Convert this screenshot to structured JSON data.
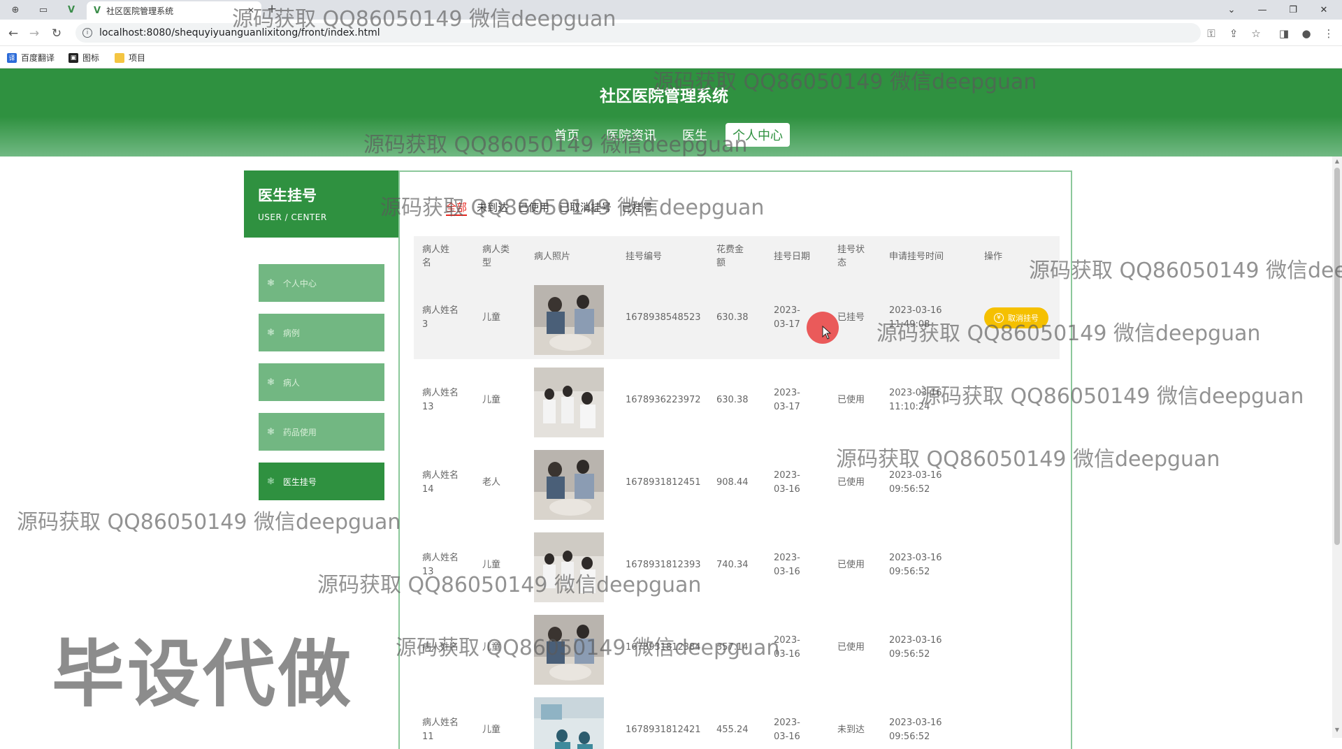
{
  "browser": {
    "tab_title": "社区医院管理系统",
    "url": "localhost:8080/shequyiyuanguanlixitong/front/index.html",
    "bookmarks": [
      "百度翻译",
      "图标",
      "项目"
    ]
  },
  "site": {
    "title": "社区医院管理系统",
    "nav": [
      "首页",
      "医院资讯",
      "医生",
      "个人中心"
    ]
  },
  "sidebar": {
    "title": "医生挂号",
    "subtitle": "USER / CENTER",
    "items": [
      "个人中心",
      "病例",
      "病人",
      "药品使用",
      "医生挂号"
    ]
  },
  "filters": [
    "全部",
    "未到达",
    "已使用",
    "已取消挂号",
    "已挂号"
  ],
  "table": {
    "headers": [
      "病人姓名",
      "病人类型",
      "病人照片",
      "挂号编号",
      "花费金额",
      "挂号日期",
      "挂号状态",
      "申请挂号时间",
      "操作"
    ],
    "rows": [
      {
        "name": "病人姓名3",
        "type": "儿童",
        "number": "1678938548523",
        "cost": "630.38",
        "date": "2023-03-17",
        "status": "已挂号",
        "applied": "2023-03-16 11:49:08",
        "action": "取消挂号"
      },
      {
        "name": "病人姓名13",
        "type": "儿童",
        "number": "1678936223972",
        "cost": "630.38",
        "date": "2023-03-17",
        "status": "已使用",
        "applied": "2023-03-16 11:10:24",
        "action": ""
      },
      {
        "name": "病人姓名14",
        "type": "老人",
        "number": "1678931812451",
        "cost": "908.44",
        "date": "2023-03-16",
        "status": "已使用",
        "applied": "2023-03-16 09:56:52",
        "action": ""
      },
      {
        "name": "病人姓名13",
        "type": "儿童",
        "number": "1678931812393",
        "cost": "740.34",
        "date": "2023-03-16",
        "status": "已使用",
        "applied": "2023-03-16 09:56:52",
        "action": ""
      },
      {
        "name": "病人姓名",
        "type": "儿童",
        "number": "1678931812384",
        "cost": "357.14",
        "date": "2023-03-16",
        "status": "已使用",
        "applied": "2023-03-16 09:56:52",
        "action": ""
      },
      {
        "name": "病人姓名11",
        "type": "儿童",
        "number": "1678931812421",
        "cost": "455.24",
        "date": "2023-03-16",
        "status": "未到达",
        "applied": "2023-03-16 09:56:52",
        "action": ""
      }
    ]
  },
  "watermarks": {
    "text": "源码获取 QQ86050149 微信deepguan",
    "big": "毕设代做"
  }
}
